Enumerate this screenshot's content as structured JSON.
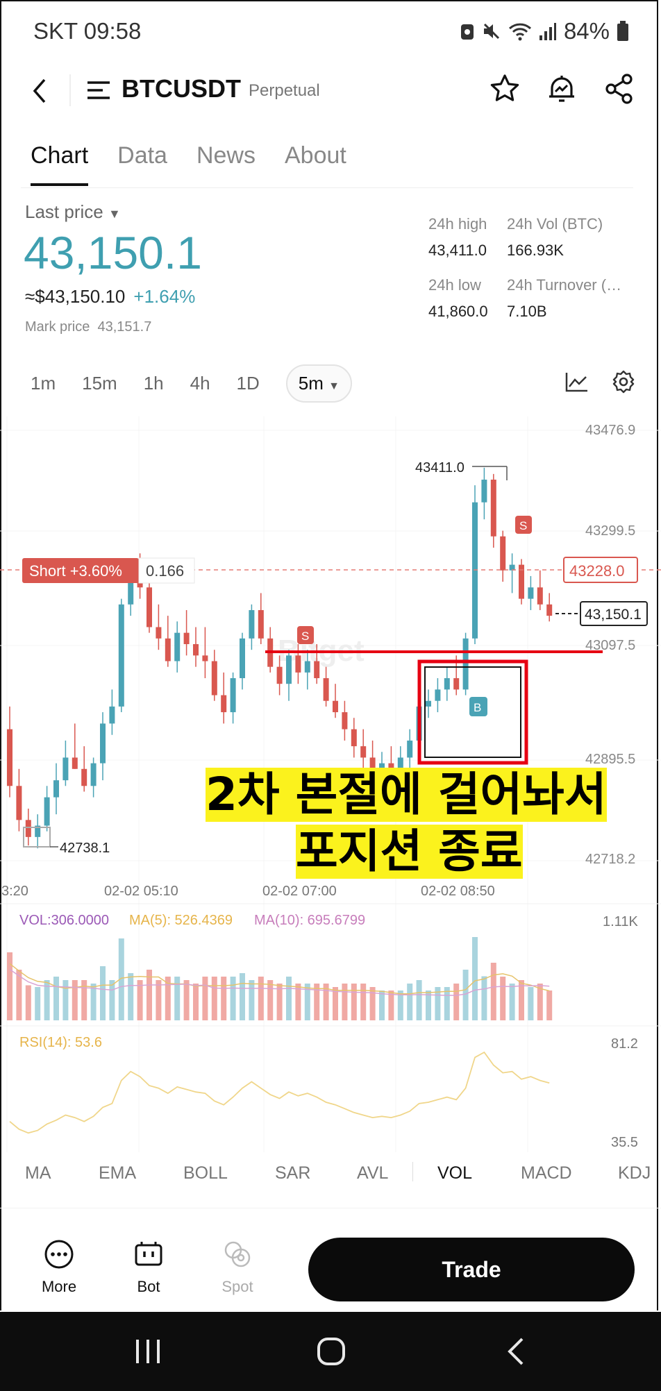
{
  "status_bar": {
    "carrier_time": "SKT 09:58",
    "battery": "84%"
  },
  "header": {
    "symbol": "BTCUSDT",
    "contract": "Perpetual"
  },
  "tabs": [
    {
      "label": "Chart"
    },
    {
      "label": "Data"
    },
    {
      "label": "News"
    },
    {
      "label": "About"
    }
  ],
  "ticker": {
    "last_price_label": "Last price",
    "last_price": "43,150.1",
    "usd_price": "≈$43,150.10",
    "change": "+1.64%",
    "mark_price_label": "Mark price",
    "mark_price": "43,151.7",
    "stats": [
      {
        "label": "24h high",
        "value": "43,411.0"
      },
      {
        "label": "24h Vol (BTC)",
        "value": "166.93K"
      },
      {
        "label": "24h low",
        "value": "41,860.0"
      },
      {
        "label": "24h Turnover (…",
        "value": "7.10B"
      }
    ]
  },
  "intervals": [
    "1m",
    "15m",
    "1h",
    "4h",
    "1D"
  ],
  "selected_interval": "5m",
  "chart": {
    "y_labels": [
      "43476.9",
      "43299.5",
      "43097.5",
      "42895.5",
      "42718.2"
    ],
    "x_labels": [
      "3:20",
      "02-02 05:10",
      "02-02 07:00",
      "02-02 08:50"
    ],
    "high_label": "43411.0",
    "low_label": "42738.1",
    "short_badge": "Short +3.60%",
    "short_qty": "0.166",
    "entry_price_label": "43228.0",
    "current_price_label": "43,150.1",
    "sell_marker": "S",
    "buy_marker": "B",
    "watermark": "Bitget",
    "vol_label": "VOL:306.0000",
    "ma5_label": "MA(5): 526.4369",
    "ma10_label": "MA(10): 695.6799",
    "vol_max": "1.11K",
    "rsi_label": "RSI(14): 53.6",
    "rsi_top": "81.2",
    "rsi_bottom": "35.5",
    "colors": {
      "up": "#4aa3b5",
      "down": "#d9574f",
      "annot": "#e60012"
    }
  },
  "annotation": {
    "line1": "2차 본절에 걸어놔서",
    "line2": "포지션 종료"
  },
  "indicators": [
    "MA",
    "EMA",
    "BOLL",
    "SAR",
    "AVL",
    "VOL",
    "MACD",
    "KDJ"
  ],
  "bottom_nav": {
    "more": "More",
    "bot": "Bot",
    "spot": "Spot",
    "trade": "Trade"
  },
  "chart_data": {
    "type": "candlestick",
    "candles": [
      [
        42950,
        42990,
        42830,
        42850
      ],
      [
        42850,
        42880,
        42770,
        42790
      ],
      [
        42790,
        42810,
        42745,
        42760
      ],
      [
        42760,
        42800,
        42740,
        42780
      ],
      [
        42780,
        42850,
        42770,
        42830
      ],
      [
        42830,
        42890,
        42800,
        42860
      ],
      [
        42860,
        42930,
        42850,
        42900
      ],
      [
        42900,
        42960,
        42880,
        42880
      ],
      [
        42880,
        42920,
        42840,
        42850
      ],
      [
        42850,
        42900,
        42830,
        42890
      ],
      [
        42890,
        42980,
        42860,
        42960
      ],
      [
        42960,
        43020,
        42940,
        42990
      ],
      [
        42990,
        43180,
        42980,
        43170
      ],
      [
        43170,
        43250,
        43150,
        43240
      ],
      [
        43240,
        43260,
        43180,
        43200
      ],
      [
        43200,
        43230,
        43120,
        43130
      ],
      [
        43130,
        43170,
        43090,
        43110
      ],
      [
        43110,
        43150,
        43060,
        43070
      ],
      [
        43070,
        43140,
        43050,
        43120
      ],
      [
        43120,
        43160,
        43080,
        43100
      ],
      [
        43100,
        43130,
        43060,
        43080
      ],
      [
        43080,
        43130,
        43040,
        43070
      ],
      [
        43070,
        43090,
        43000,
        43010
      ],
      [
        43010,
        43050,
        42960,
        42980
      ],
      [
        42980,
        43050,
        42960,
        43040
      ],
      [
        43040,
        43120,
        43020,
        43110
      ],
      [
        43110,
        43170,
        43090,
        43160
      ],
      [
        43160,
        43190,
        43100,
        43110
      ],
      [
        43110,
        43130,
        43050,
        43060
      ],
      [
        43060,
        43080,
        43010,
        43030
      ],
      [
        43030,
        43090,
        43000,
        43080
      ],
      [
        43080,
        43100,
        43030,
        43050
      ],
      [
        43050,
        43090,
        43020,
        43070
      ],
      [
        43070,
        43100,
        43030,
        43040
      ],
      [
        43040,
        43060,
        42990,
        43000
      ],
      [
        43000,
        43030,
        42970,
        42980
      ],
      [
        42980,
        43000,
        42930,
        42950
      ],
      [
        42950,
        42970,
        42900,
        42920
      ],
      [
        42920,
        42950,
        42880,
        42900
      ],
      [
        42900,
        42930,
        42870,
        42880
      ],
      [
        42880,
        42910,
        42860,
        42890
      ],
      [
        42890,
        42920,
        42870,
        42880
      ],
      [
        42880,
        42920,
        42870,
        42900
      ],
      [
        42900,
        42950,
        42880,
        42930
      ],
      [
        42930,
        43000,
        42920,
        42990
      ],
      [
        42990,
        43020,
        42970,
        43000
      ],
      [
        43000,
        43040,
        42980,
        43020
      ],
      [
        43020,
        43060,
        43000,
        43040
      ],
      [
        43040,
        43080,
        43010,
        43020
      ],
      [
        43020,
        43120,
        43010,
        43110
      ],
      [
        43110,
        43380,
        43100,
        43350
      ],
      [
        43350,
        43411,
        43320,
        43390
      ],
      [
        43390,
        43400,
        43270,
        43290
      ],
      [
        43290,
        43300,
        43210,
        43230
      ],
      [
        43230,
        43260,
        43190,
        43240
      ],
      [
        43240,
        43250,
        43170,
        43180
      ],
      [
        43180,
        43220,
        43160,
        43200
      ],
      [
        43200,
        43230,
        43160,
        43170
      ],
      [
        43170,
        43190,
        43140,
        43150
      ]
    ],
    "ylim": [
      42718.2,
      43476.9
    ]
  }
}
